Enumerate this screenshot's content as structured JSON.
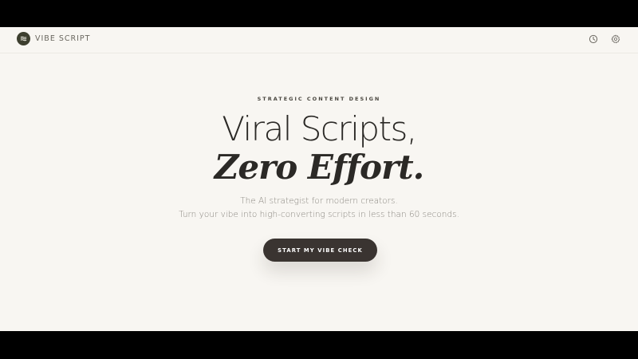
{
  "brand": {
    "name": "VIBE SCRIPT",
    "logo_icon": "waves-icon",
    "logo_color": "#3d3f2f"
  },
  "header_icons": [
    {
      "name": "history-icon"
    },
    {
      "name": "settings-icon"
    }
  ],
  "hero": {
    "eyebrow": "STRATEGIC CONTENT DESIGN",
    "headline_line1": "Viral Scripts,",
    "headline_line2": "Zero Effort.",
    "subtitle_line1": "The AI strategist for modern creators.",
    "subtitle_line2": "Turn your vibe into high-converting scripts in less than 60 seconds.",
    "cta_label": "START MY VIBE CHECK"
  },
  "colors": {
    "background": "#f8f6f2",
    "text_dark": "#2b2926",
    "button": "#3a3431",
    "subtitle": "#8a8780"
  }
}
